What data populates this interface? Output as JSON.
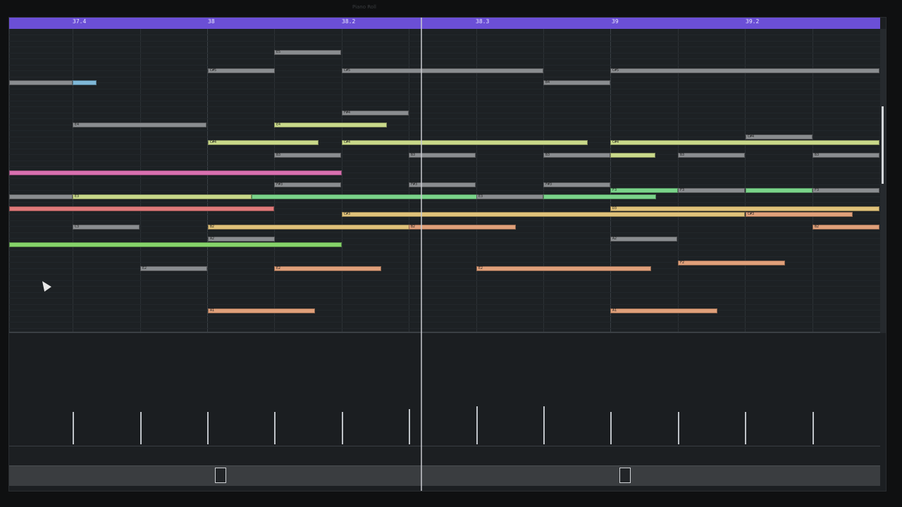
{
  "window": {
    "title": "Piano Roll"
  },
  "ruler": {
    "labels": [
      "37.4",
      "38",
      "38.2",
      "38.3",
      "39",
      "39.2"
    ]
  },
  "notes": [
    {
      "label": "E5",
      "color": "#8a8d90"
    },
    {
      "label": "C#5",
      "color": "#8a8d90"
    },
    {
      "label": "C#5",
      "color": "#8a8d90"
    },
    {
      "label": "C#5",
      "color": "#8a8d90"
    },
    {
      "label": "",
      "color": "#8a8d90"
    },
    {
      "label": "",
      "color": "#7fb8d8"
    },
    {
      "label": "B4",
      "color": "#8a8d90"
    },
    {
      "label": "F#4",
      "color": "#8a8d90"
    },
    {
      "label": "E4",
      "color": "#8a8d90"
    },
    {
      "label": "E4",
      "color": "#c9d98a"
    },
    {
      "label": "C#4",
      "color": "#c9d98a"
    },
    {
      "label": "C#4",
      "color": "#c9d98a"
    },
    {
      "label": "C#4",
      "color": "#c9d98a"
    },
    {
      "label": "C#4",
      "color": "#8a8d90"
    },
    {
      "label": "B3",
      "color": "#8a8d90"
    },
    {
      "label": "B3",
      "color": "#8a8d90"
    },
    {
      "label": "B3",
      "color": "#8a8d90"
    },
    {
      "label": "",
      "color": "#c9d98a"
    },
    {
      "label": "B3",
      "color": "#8a8d90"
    },
    {
      "label": "B3",
      "color": "#8a8d90"
    },
    {
      "label": "",
      "color": "#d970b0"
    },
    {
      "label": "F#3",
      "color": "#8a8d90"
    },
    {
      "label": "F#3",
      "color": "#8a8d90"
    },
    {
      "label": "F#3",
      "color": "#8a8d90"
    },
    {
      "label": "F3",
      "color": "#7ad48a"
    },
    {
      "label": "F3",
      "color": "#8a8d90"
    },
    {
      "label": "",
      "color": "#7ad48a"
    },
    {
      "label": "F3",
      "color": "#8a8d90"
    },
    {
      "label": "",
      "color": "#8a8d90"
    },
    {
      "label": "E3",
      "color": "#c9d98a"
    },
    {
      "label": "",
      "color": "#7ad48a"
    },
    {
      "label": "E3",
      "color": "#8a8d90"
    },
    {
      "label": "",
      "color": "#7ad48a"
    },
    {
      "label": "",
      "color": "#e07a7a"
    },
    {
      "label": "D3",
      "color": "#e0c27a"
    },
    {
      "label": "C#3",
      "color": "#e0c27a"
    },
    {
      "label": "C#3",
      "color": "#e0a07a"
    },
    {
      "label": "C3",
      "color": "#8a8d90"
    },
    {
      "label": "B2",
      "color": "#e0c27a"
    },
    {
      "label": "B2",
      "color": "#e0a07a"
    },
    {
      "label": "B2",
      "color": "#e0a07a"
    },
    {
      "label": "A2",
      "color": "#8a8d90"
    },
    {
      "label": "A2",
      "color": "#8a8d90"
    },
    {
      "label": "",
      "color": "#86d46a"
    },
    {
      "label": "F2",
      "color": "#e0a07a"
    },
    {
      "label": "E2",
      "color": "#8a8d90"
    },
    {
      "label": "E2",
      "color": "#e0a07a"
    },
    {
      "label": "E2",
      "color": "#e0a07a"
    },
    {
      "label": "A1",
      "color": "#e0a07a"
    },
    {
      "label": "A1",
      "color": "#e0a07a"
    }
  ],
  "velocity": {
    "count": 12
  },
  "scrollbar": {
    "handles": 2
  }
}
